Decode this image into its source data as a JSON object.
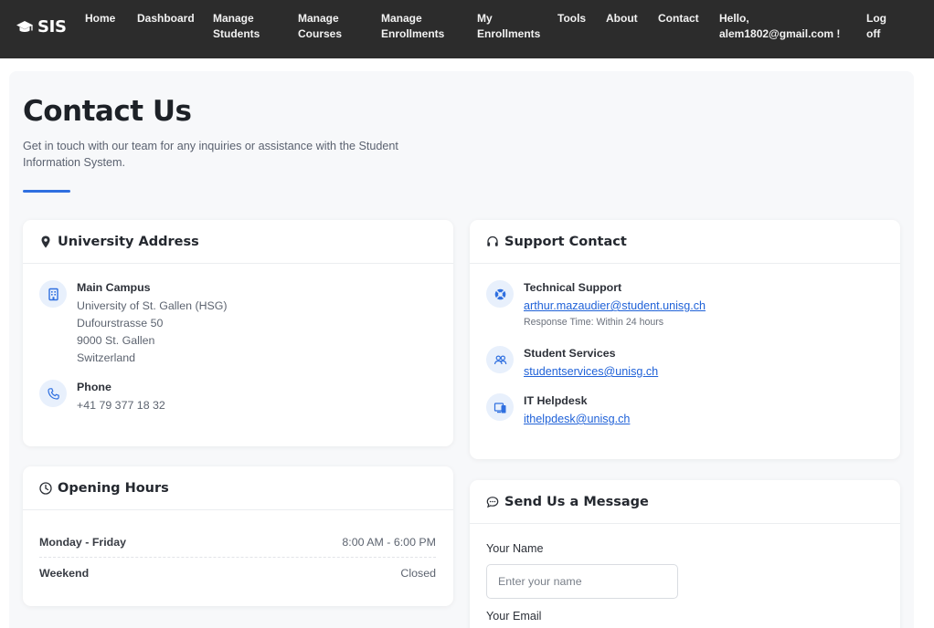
{
  "brand": {
    "name": "SIS",
    "icon": "graduation-cap-icon"
  },
  "nav": {
    "home": "Home",
    "dashboard": "Dashboard",
    "manage_students_1": "Manage",
    "manage_students_2": "Students",
    "manage_courses_1": "Manage",
    "manage_courses_2": "Courses",
    "manage_enrollments_1": "Manage",
    "manage_enrollments_2": "Enrollments",
    "my_enrollments_1": "My",
    "my_enrollments_2": "Enrollments",
    "tools": "Tools",
    "about": "About",
    "contact": "Contact",
    "hello_1": "Hello,",
    "hello_2": "alem1802@gmail.com !",
    "logoff_1": "Log",
    "logoff_2": "off"
  },
  "page": {
    "title": "Contact Us",
    "subtitle": "Get in touch with our team for any inquiries or assistance with the Student Information System."
  },
  "address_card": {
    "title": "University Address",
    "campus_title": "Main Campus",
    "campus_lines": [
      "University of St. Gallen (HSG)",
      "Dufourstrasse 50",
      "9000 St. Gallen",
      "Switzerland"
    ],
    "phone_title": "Phone",
    "phone_value": "+41 79 377 18 32"
  },
  "hours_card": {
    "title": "Opening Hours",
    "rows": [
      {
        "day": "Monday - Friday",
        "time": "8:00 AM - 6:00 PM"
      },
      {
        "day": "Weekend",
        "time": "Closed"
      }
    ]
  },
  "support_card": {
    "title": "Support Contact",
    "items": [
      {
        "title": "Technical Support",
        "email": "arthur.mazaudier@student.unisg.ch",
        "note": "Response Time: Within 24 hours"
      },
      {
        "title": "Student Services",
        "email": "studentservices@unisg.ch"
      },
      {
        "title": "IT Helpdesk",
        "email": "ithelpdesk@unisg.ch"
      }
    ]
  },
  "message_card": {
    "title": "Send Us a Message",
    "name_label": "Your Name",
    "name_placeholder": "Enter your name",
    "email_label": "Your Email"
  },
  "colors": {
    "accent": "#2f6fe0",
    "navbar": "#2c2c2c",
    "link": "#2062d8",
    "icon_bg": "#e8f0fc"
  }
}
